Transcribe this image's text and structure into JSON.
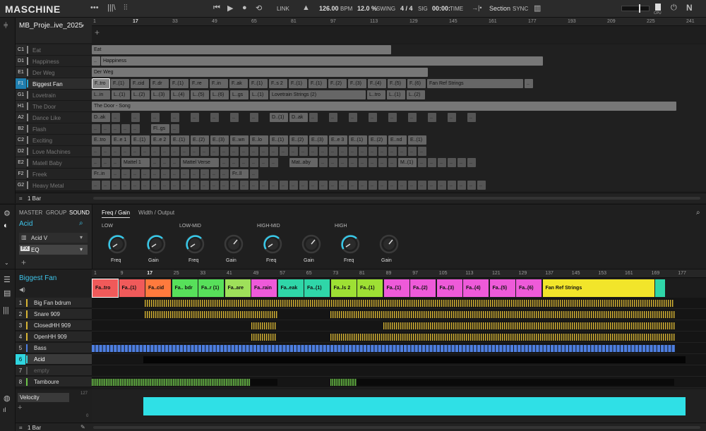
{
  "app": {
    "logo": "MASCHINE"
  },
  "transport": {
    "bpm": "126.00",
    "bpm_unit": "BPM",
    "swing": "12.0 %",
    "swing_label": "SWING",
    "sig": "4 / 4",
    "sig_label": "SIG",
    "time": "00:00:",
    "time_label": "TIME",
    "link": "LINK",
    "section": "Section",
    "sync": "SYNC",
    "cpu": "CPU"
  },
  "arranger": {
    "project": "MB_Proje..ive_2025",
    "bar_length": "1 Bar",
    "ruler": [
      "1",
      "17",
      "33",
      "49",
      "65",
      "81",
      "97",
      "113",
      "129",
      "145",
      "161",
      "177",
      "193",
      "209",
      "225",
      "241"
    ],
    "groups": [
      {
        "id": "C1",
        "name": "Eat",
        "color": "#8a8a8a"
      },
      {
        "id": "D1",
        "name": "Happiness",
        "color": "#9a9a9a"
      },
      {
        "id": "E1",
        "name": "Der Weg",
        "color": "#8a8a8a"
      },
      {
        "id": "F1",
        "name": "Biggest Fan",
        "color": "#2aa9d6"
      },
      {
        "id": "G1",
        "name": "Lovetrain",
        "color": "#8a8a8a"
      },
      {
        "id": "H1",
        "name": "The Door",
        "color": "#8a8a8a"
      },
      {
        "id": "A2",
        "name": "Dance Like",
        "color": "#8a8a8a"
      },
      {
        "id": "B2",
        "name": "Flash",
        "color": "#8a8a8a"
      },
      {
        "id": "C2",
        "name": "Exciting",
        "color": "#8a8a8a"
      },
      {
        "id": "D2",
        "name": "Love Machines",
        "color": "#8a8a8a"
      },
      {
        "id": "E2",
        "name": "Matell Baby",
        "color": "#8a8a8a"
      },
      {
        "id": "F2",
        "name": "Freek",
        "color": "#8a8a8a"
      },
      {
        "id": "G2",
        "name": "Heavy Metal",
        "color": "#8a8a8a"
      }
    ],
    "labels": {
      "eat": "Eat",
      "happiness": "Happiness",
      "derweg": "Der Weg",
      "ftro": "F..tro",
      "f1": "F..(1)",
      "fcid": "F..cid",
      "fdr": "F..dr",
      "f1b": "F..(1)",
      "fre": "F..re",
      "fin": "F..in",
      "fak": "F..ak",
      "f1c": "F..(1)",
      "fs2": "F..s 2",
      "f1d": "F..(1)",
      "f2": "F..(2)",
      "f3": "F..(3)",
      "f4": "F..(4)",
      "f5": "F..(5)",
      "f6": "F..(6)",
      "fanref": "Fan Ref Strings",
      "dots": "..",
      "lin": "L..in",
      "l1": "L..(1)",
      "l2": "L..(2)",
      "l3": "L..(3)",
      "l4": "L..(4)",
      "l5": "L..(5)",
      "l6": "L..(6)",
      "lgs": "L..gs",
      "l1b": "L..(1)",
      "lovetrain2": "Lovetrain Strings (2)",
      "ltro": "L..tro",
      "l1c": "L..(1)",
      "l2b": "L..(2)",
      "door": "The Door - Song",
      "dak": "D..ak",
      "d1": "D..(1)",
      "dak2": "D..ak",
      "flgs": "Fl..gs",
      "etro": "E..tro",
      "ee1": "E..e 1",
      "e1": "E..(1)",
      "ee2": "E..e 2",
      "e1b": "E..(1)",
      "e2": "E..(2)",
      "e3": "E..(3)",
      "ewn": "E..wn",
      "elo": "E..lo",
      "e1c": "E..(1)",
      "e2b": "E..(2)",
      "e3b": "E..(3)",
      "ee3": "E..e 3",
      "e1d": "E..(1)",
      "e2c": "E..(2)",
      "end": "E..nd",
      "e1e": "E..(1)",
      "mattel1": "Mattel 1",
      "mattelverse": "Mattel  Verse",
      "mataby": "Mat..aby",
      "m1": "M..(1)",
      "frin": "Fr..in",
      "frll": "Fr..ll"
    }
  },
  "sound": {
    "tabs": [
      "MASTER",
      "GROUP",
      "SOUND"
    ],
    "name": "Acid",
    "plugin": "Acid V",
    "fx": "EQ",
    "fx_badge": "FX",
    "eq_tabs": [
      "Freq / Gain",
      "Width / Output"
    ],
    "bands": [
      "LOW",
      "LOW-MID",
      "HIGH-MID",
      "HIGH"
    ],
    "freq": "Freq",
    "gain": "Gain"
  },
  "pattern": {
    "group": "Biggest Fan",
    "bar_length": "1 Bar",
    "ruler": [
      "1",
      "9",
      "17",
      "25",
      "33",
      "41",
      "49",
      "57",
      "65",
      "73",
      "81",
      "89",
      "97",
      "105",
      "113",
      "121",
      "129",
      "137",
      "145",
      "153",
      "161",
      "169",
      "177"
    ],
    "patterns": [
      {
        "name": "Fa..tro",
        "color": "#f05a5a"
      },
      {
        "name": "Fa..(1)",
        "color": "#f05a5a"
      },
      {
        "name": "Fa..cid",
        "color": "#ff7a3d"
      },
      {
        "name": "Fa.. bdr",
        "color": "#57e05a"
      },
      {
        "name": "Fa..r (1)",
        "color": "#57e05a"
      },
      {
        "name": "Fa..are",
        "color": "#9ee05a"
      },
      {
        "name": "Fa..rain",
        "color": "#ee5ad9"
      },
      {
        "name": "Fa..eak",
        "color": "#2fd6a8"
      },
      {
        "name": "Fa..(1)",
        "color": "#2fd6a8"
      },
      {
        "name": "Fa..ls 2",
        "color": "#9ee034"
      },
      {
        "name": "Fa..(1)",
        "color": "#9ee034"
      },
      {
        "name": "Fa..(1)",
        "color": "#ee5ad9"
      },
      {
        "name": "Fa..(2)",
        "color": "#ee5ad9"
      },
      {
        "name": "Fa..(3)",
        "color": "#ee5ad9"
      },
      {
        "name": "Fa..(4)",
        "color": "#ee5ad9"
      },
      {
        "name": "Fa..(5)",
        "color": "#ee5ad9"
      },
      {
        "name": "Fa..(6)",
        "color": "#ee5ad9"
      },
      {
        "name": "Fan Ref Strings",
        "color": "#f2e52a"
      },
      {
        "name": "",
        "color": "#2fd6a8"
      }
    ],
    "sounds": [
      {
        "num": "1",
        "name": "Big Fan bdrum",
        "color": "#d8b534"
      },
      {
        "num": "2",
        "name": "Snare 909",
        "color": "#d8b534"
      },
      {
        "num": "3",
        "name": "ClosedHH 909",
        "color": "#d8b534"
      },
      {
        "num": "4",
        "name": "OpenHH 909",
        "color": "#d8b534"
      },
      {
        "num": "5",
        "name": "Bass",
        "color": "#4d7ee0"
      },
      {
        "num": "6",
        "name": "Acid",
        "color": "#2fd6e0"
      },
      {
        "num": "7",
        "name": "empty",
        "color": "#555"
      },
      {
        "num": "8",
        "name": "Tamboure",
        "color": "#6ec64a"
      }
    ],
    "velocity": "Velocity",
    "vel_max": "127",
    "vel_min": "0"
  }
}
